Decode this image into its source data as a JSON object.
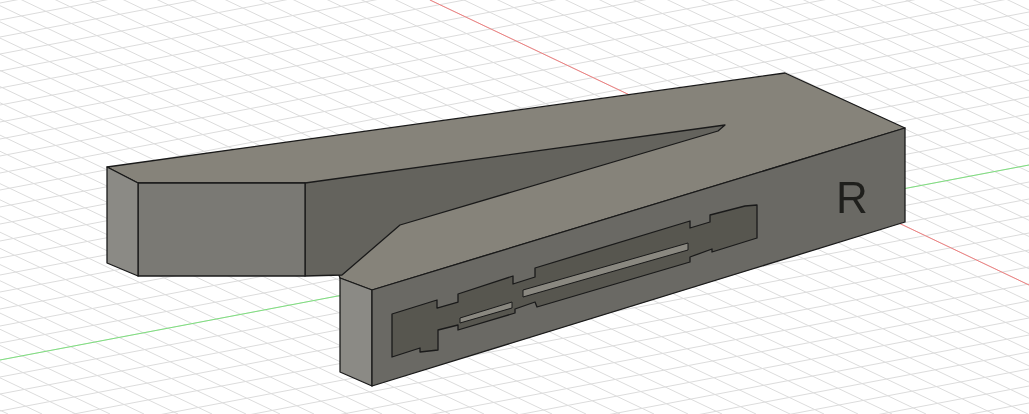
{
  "viewport": {
    "model": {
      "engraved_letter": "R"
    }
  }
}
